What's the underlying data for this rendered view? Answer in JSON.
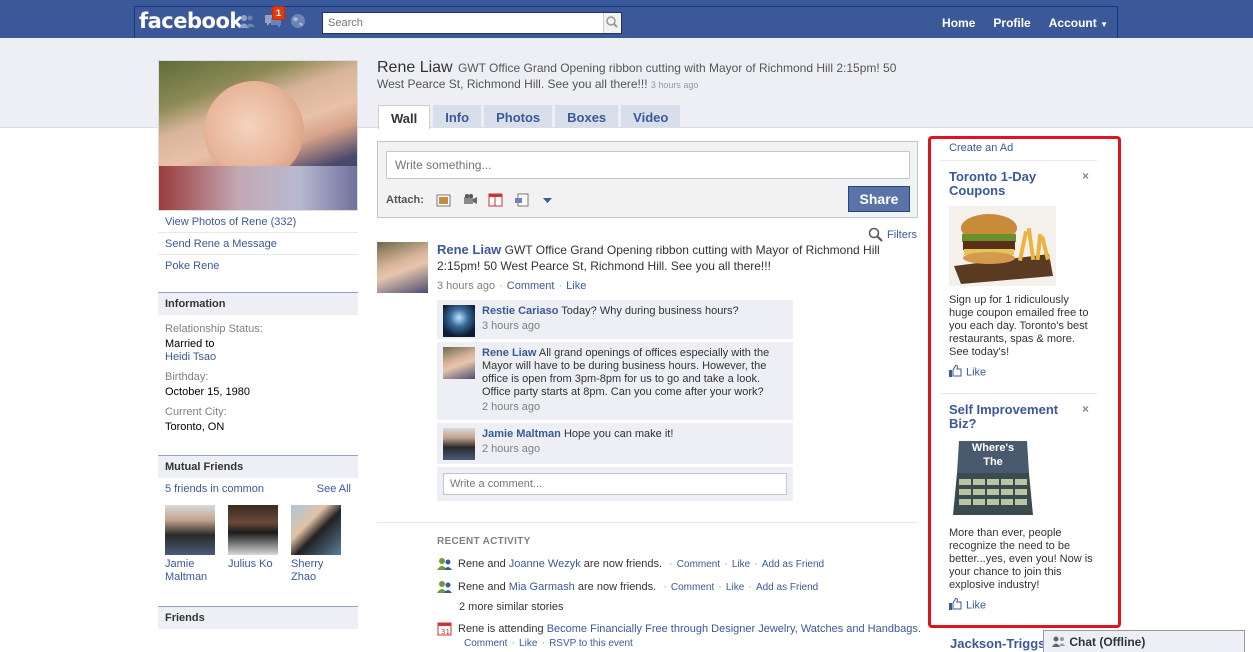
{
  "topbar": {
    "logo": "facebook",
    "notification_count": "1",
    "search_placeholder": "Search",
    "nav": [
      "Home",
      "Profile",
      "Account"
    ]
  },
  "left": {
    "links": [
      "View Photos of Rene (332)",
      "Send Rene a Message",
      "Poke Rene"
    ],
    "information": {
      "heading": "Information",
      "relationship_label": "Relationship Status:",
      "relationship_value": "Married to",
      "relationship_partner": "Heidi Tsao",
      "birthday_label": "Birthday:",
      "birthday_value": "October 15, 1980",
      "city_label": "Current City:",
      "city_value": "Toronto, ON"
    },
    "mutual": {
      "heading": "Mutual Friends",
      "count_text": "5 friends in common",
      "see_all": "See All",
      "friends": [
        {
          "name_line1": "Jamie",
          "name_line2": "Maltman"
        },
        {
          "name_line1": "Julius Ko",
          "name_line2": ""
        },
        {
          "name_line1": "Sherry",
          "name_line2": "Zhao"
        }
      ]
    },
    "friends_heading": "Friends"
  },
  "main": {
    "name": "Rene Liaw",
    "status": "GWT Office Grand Opening ribbon cutting with Mayor of Richmond Hill 2:15pm! 50 West Pearce St, Richmond Hill. See you all there!!!",
    "status_time": "3 hours ago",
    "tabs": [
      "Wall",
      "Info",
      "Photos",
      "Boxes",
      "Video"
    ],
    "composer_placeholder": "Write something...",
    "attach_label": "Attach:",
    "share_label": "Share",
    "filters_label": "Filters",
    "story": {
      "author": "Rene Liaw",
      "text": "GWT Office Grand Opening ribbon cutting with Mayor of Richmond Hill 2:15pm! 50 West Pearce St, Richmond Hill. See you all there!!!",
      "time": "3 hours ago",
      "comment_link": "Comment",
      "like_link": "Like",
      "comments": [
        {
          "author": "Restie Cariaso",
          "text": "Today? Why during business hours?",
          "time": "3 hours ago"
        },
        {
          "author": "Rene Liaw",
          "text": "All grand openings of offices especially with the Mayor will have to be during business hours. However, the office is open from 3pm-8pm for us to go and take a look. Office party starts at 8pm. Can you come after your work?",
          "time": "2 hours ago"
        },
        {
          "author": "Jamie Maltman",
          "text": "Hope you can make it!",
          "time": "2 hours ago"
        }
      ],
      "comment_placeholder": "Write a comment..."
    },
    "recent": {
      "heading": "RECENT ACTIVITY",
      "row1": {
        "pre": "Rene and",
        "friend": "Joanne Wezyk",
        "post": "are now friends.",
        "a1": "Comment",
        "a2": "Like",
        "a3": "Add as Friend"
      },
      "row2": {
        "pre": "Rene and",
        "friend": "Mia Garmash",
        "post": "are now friends.",
        "a1": "Comment",
        "a2": "Like",
        "a3": "Add as Friend"
      },
      "more": "2 more similar stories",
      "row3": {
        "pre": "Rene is attending",
        "event": "Become Financially Free through Designer Jewelry, Watches and Handbags.",
        "a1": "Comment",
        "a2": "Like",
        "a3": "RSVP to this event"
      }
    }
  },
  "ads": {
    "create_ad": "Create an Ad",
    "items": [
      {
        "title": "Toronto 1-Day Coupons",
        "text": "Sign up for 1 ridiculously huge coupon emailed free to you each day. Toronto's best restaurants, spas & more. See today's!",
        "like": "Like"
      },
      {
        "title": "Self Improvement Biz?",
        "image_text_1": "Where's",
        "image_text_2": "The",
        "text": "More than ever, people recognize the need to be better...yes, even you! Now is your chance to join this explosive industry!",
        "like": "Like"
      }
    ],
    "next_title": "Jackson-Triggs",
    "highlight_color": "#e0141e"
  },
  "chat": {
    "label": "Chat (Offline)"
  },
  "colors": {
    "brand": "#3b5998",
    "band": "#edeff4"
  }
}
